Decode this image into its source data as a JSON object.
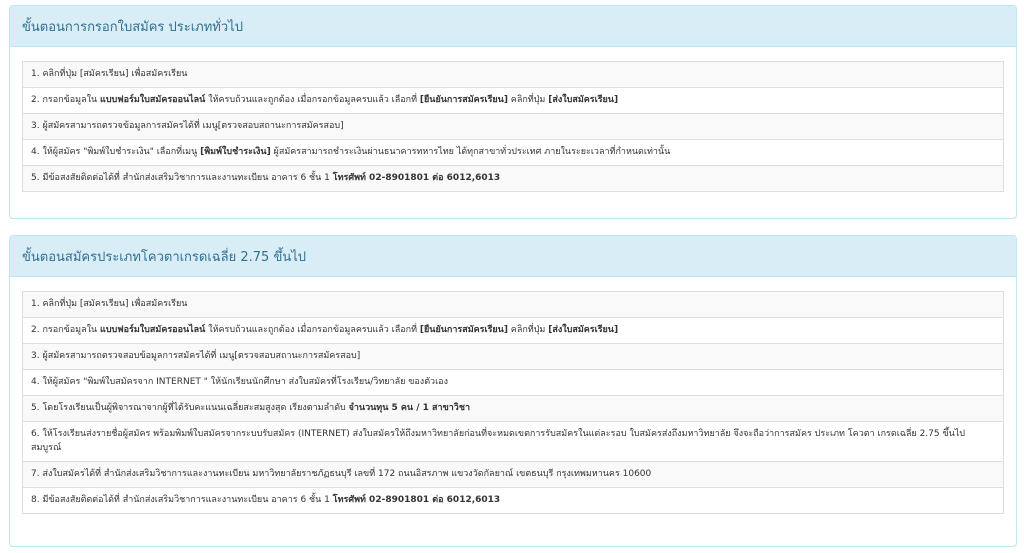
{
  "general": {
    "title": "ขั้นตอนการกรอกใบสมัคร ประเภททั่วไป",
    "steps": [
      {
        "n": "1. ",
        "a": "คลิกที่ปุ่ม [สมัครเรียน] เพื่อสมัครเรียน"
      },
      {
        "n": "2. ",
        "a": "กรอกข้อมูลใน ",
        "b": "แบบฟอร์มใบสมัครออนไลน์",
        "c": " ให้ครบถ้วนและถูกต้อง เมื่อกรอกข้อมูลครบแล้ว เลือกที่ ",
        "d": "[ยืนยันการสมัครเรียน]",
        "e": " คลิกที่ปุ่ม ",
        "f": "[ส่งใบสมัครเรียน]"
      },
      {
        "n": "3. ",
        "a": "ผู้สมัครสามารถตรวจข้อมูลการสมัครได้ที่ เมนู[ตรวจสอบสถานะการสมัครสอบ]"
      },
      {
        "n": "4. ",
        "a": "ให้ผู้สมัคร \"พิมพ์ใบชำระเงิน\" เลือกที่เมนู ",
        "b": "[พิมพ์ใบชำระเงิน]",
        "c": " ผู้สมัครสามารถชำระเงินผ่านธนาคารทหารไทย ได้ทุกสาขาทั่วประเทศ ภายในระยะเวลาที่กำหนดเท่านั้น"
      },
      {
        "n": "5. ",
        "a": "มีข้อสงสัยติดต่อได้ที่ สำนักส่งเสริมวิชาการและงานทะเบียน อาคาร 6 ชั้น 1 ",
        "b": "โทรศัพท์ 02-8901801 ต่อ 6012,6013"
      }
    ]
  },
  "quota": {
    "title": "ขั้นตอนสมัครประเภทโควตาเกรดเฉลี่ย 2.75 ขึ้นไป",
    "steps": [
      {
        "n": "1. ",
        "a": "คลิกที่ปุ่ม [สมัครเรียน] เพื่อสมัครเรียน"
      },
      {
        "n": "2. ",
        "a": "กรอกข้อมูลใน ",
        "b": "แบบฟอร์มใบสมัครออนไลน์",
        "c": " ให้ครบถ้วนและถูกต้อง เมื่อกรอกข้อมูลครบแล้ว เลือกที่ ",
        "d": "[ยืนยันการสมัครเรียน]",
        "e": " คลิกที่ปุ่ม ",
        "f": "[ส่งใบสมัครเรียน]"
      },
      {
        "n": "3. ",
        "a": "ผู้สมัครสามารถตรวจสอบข้อมูลการสมัครได้ที่ เมนู[ตรวจสอบสถานะการสมัครสอบ]"
      },
      {
        "n": "4. ",
        "a": "ให้ผู้สมัคร \"พิมพ์ใบสมัครจาก INTERNET \" ให้นักเรียนนักศึกษา ส่งใบสมัครที่โรงเรียน/วิทยาลัย ของตัวเอง"
      },
      {
        "n": "5. ",
        "a": "โดยโรงเรียนเป็นผู้พิจารณาจากผู้ที่ได้รับคะแนนเฉลี่ยสะสมสูงสุด เรียงตามลำดับ ",
        "b": "จำนวนทุน 5 คน / 1 สาขาวิชา"
      },
      {
        "n": "6. ",
        "a": "ให้โรงเรียนส่งรายชื่อผู้สมัคร พร้อมพิมพ์ใบสมัครจากระบบรับสมัคร (INTERNET) ส่งใบสมัครให้ถึงมหาวิทยาลัยก่อนที่จะหมดเขตการรับสมัครในแต่ละรอบ ใบสมัครส่งถึงมหาวิทยาลัย จึงจะถือว่าการสมัคร ประเภท โควตา เกรดเฉลี่ย 2.75 ขึ้นไป สมบูรณ์"
      },
      {
        "n": "7. ",
        "a": "ส่งใบสมัครได้ที่ สำนักส่งเสริมวิชาการและงานทะเบียน มหาวิทยาลัยราชภัฏธนบุรี เลขที่ 172 ถนนอิสรภาพ แขวงวัดกัลยาณ์ เขตธนบุรี กรุงเทพมหานคร 10600"
      },
      {
        "n": "8. ",
        "a": "มีข้อสงสัยติดต่อได้ที่ สำนักส่งเสริมวิชาการและงานทะเบียน อาคาร 6 ชั้น 1 ",
        "b": "โทรศัพท์ 02-8901801 ต่อ 6012,6013"
      }
    ]
  }
}
